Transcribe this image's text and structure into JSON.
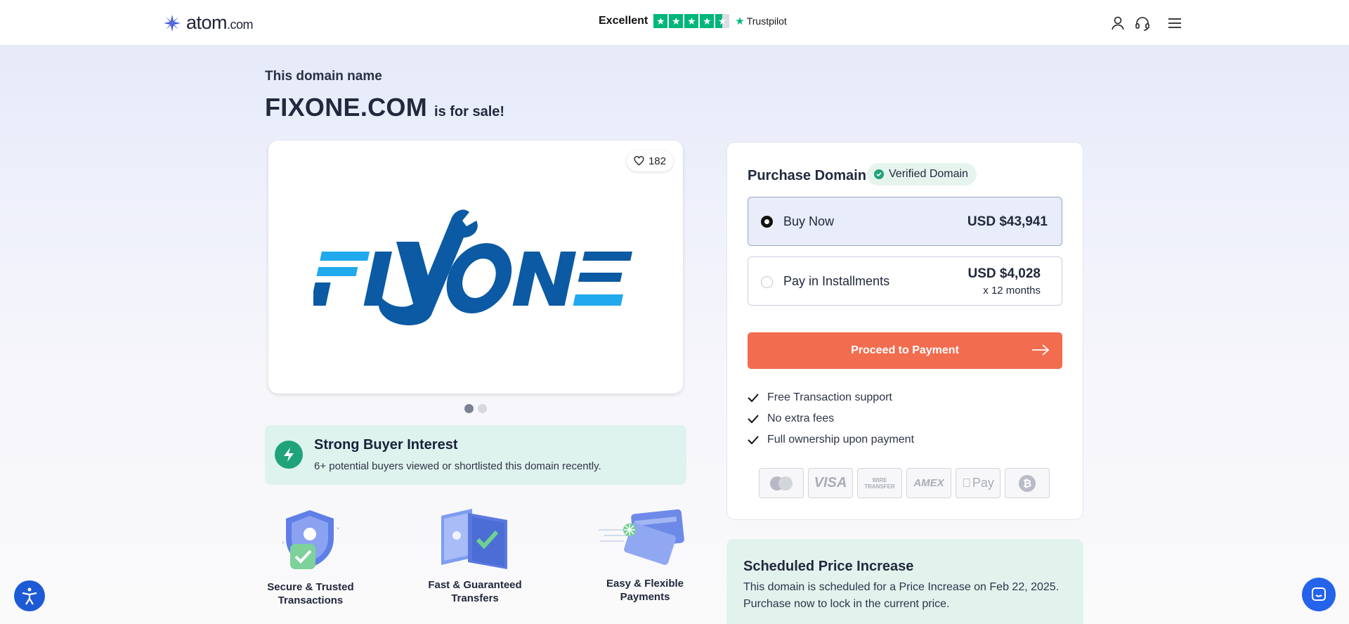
{
  "header": {
    "logo_text": "atom",
    "logo_suffix": ".com",
    "trust_label": "Excellent",
    "trustpilot_label": "Trustpilot",
    "rating_stars": 4.5,
    "icons": [
      "user-icon",
      "headset-icon",
      "menu-icon"
    ]
  },
  "hero": {
    "kicker": "This domain name",
    "domain": "FIXONE.COM",
    "for_sale": "is for sale!"
  },
  "gallery": {
    "logo_text": "FIXONE",
    "likes": "182",
    "slide_count": 2,
    "active_slide": 1
  },
  "interest": {
    "title": "Strong Buyer Interest",
    "description": "6+ potential buyers viewed or shortlisted this domain recently."
  },
  "features": [
    {
      "line1": "Secure & Trusted",
      "line2": "Transactions"
    },
    {
      "line1": "Fast & Guaranteed",
      "line2": "Transfers"
    },
    {
      "line1": "Easy & Flexible",
      "line2": "Payments"
    }
  ],
  "purchase": {
    "title": "Purchase Domain",
    "verified": "Verified Domain",
    "options": [
      {
        "label": "Buy Now",
        "price": "USD $43,941",
        "selected": true
      },
      {
        "label": "Pay in Installments",
        "price": "USD $4,028",
        "sub": "x 12 months",
        "selected": false
      }
    ],
    "cta": "Proceed to Payment",
    "benefits": [
      "Free Transaction support",
      "No extra fees",
      "Full ownership upon payment"
    ],
    "payment_methods": [
      "mastercard",
      "VISA",
      "WIRE TRANSFER",
      "AMEX",
      "Pay",
      "bitcoin"
    ]
  },
  "scheduled": {
    "title": "Scheduled Price Increase",
    "text": "This domain is scheduled for a Price Increase on Feb 22, 2025. Purchase now to lock in the current price."
  },
  "colors": {
    "accent": "#f26c4f",
    "green": "#1fa37a",
    "trustpilot": "#00b67a",
    "logo_dark": "#0b5aa3",
    "logo_light": "#20a9ec"
  }
}
